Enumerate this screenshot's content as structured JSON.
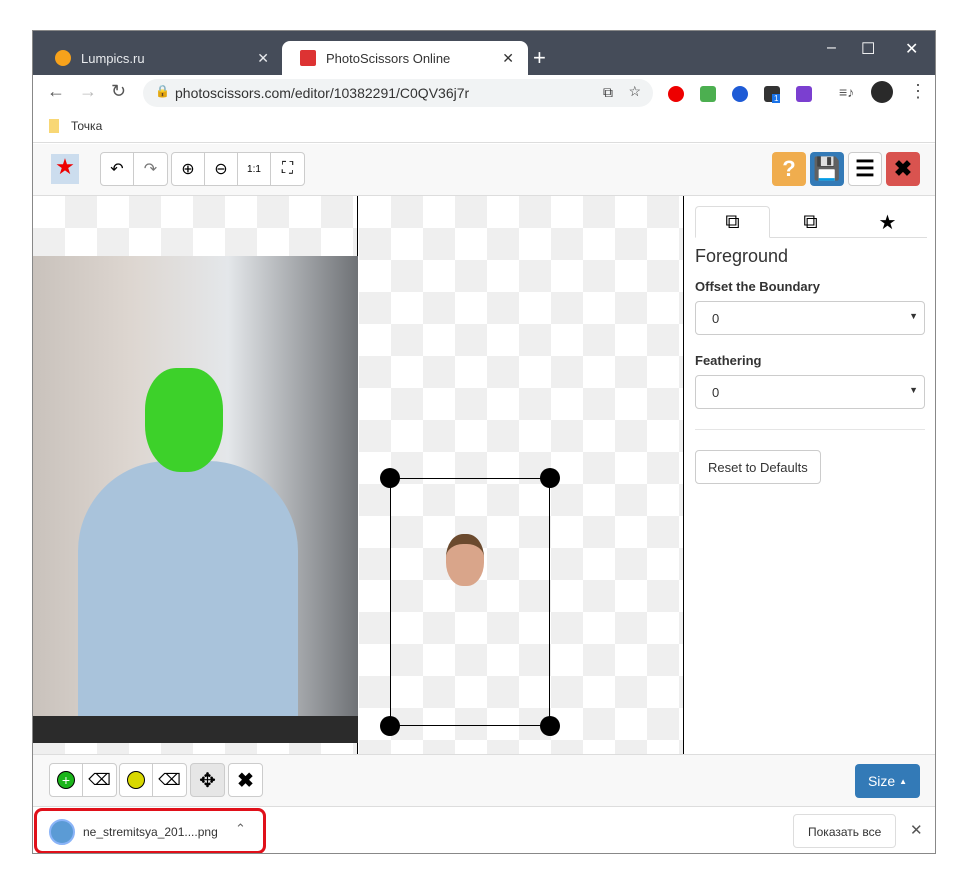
{
  "browser": {
    "tabs": [
      {
        "label": "Lumpics.ru",
        "active": false
      },
      {
        "label": "PhotoScissors Online",
        "active": true
      }
    ],
    "url": "photoscissors.com/editor/10382291/C0QV36j7r",
    "bookmark": "Точка",
    "extension_badge": "1"
  },
  "toolbar": {
    "help": "?",
    "size_label": "Size"
  },
  "panel": {
    "title": "Foreground",
    "offset_label": "Offset the Boundary",
    "offset_value": "0",
    "feathering_label": "Feathering",
    "feathering_value": "0",
    "reset_label": "Reset to Defaults"
  },
  "download": {
    "filename": "ne_stremitsya_201....png",
    "show_all": "Показать все"
  },
  "colors": {
    "help": "#f0ad4e",
    "save": "#337ab7",
    "close": "#d9534f",
    "size": "#337ab7",
    "highlight": "#e0101a",
    "foreground_mark": "#3dd12a"
  }
}
